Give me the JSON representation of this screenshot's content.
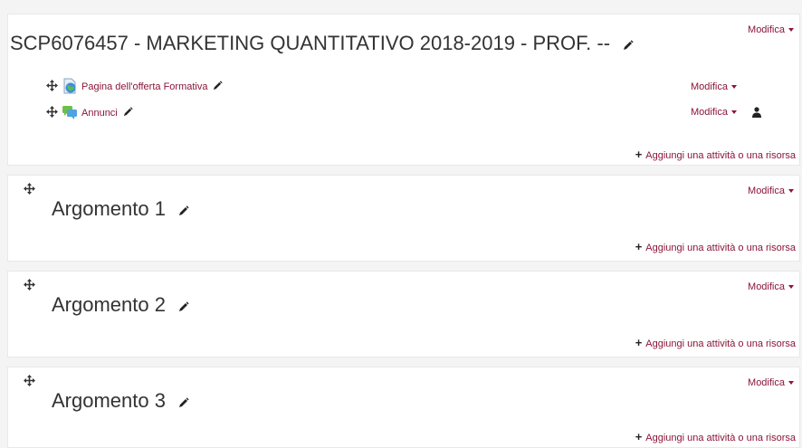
{
  "sections": [
    {
      "title": "SCP6076457 - MARKETING QUANTITATIVO 2018-2019 - PROF. --",
      "edit_label": "Modifica",
      "add_label": "Aggiungi una attività o una risorsa",
      "activities": [
        {
          "name": "Pagina dell'offerta Formativa",
          "icon": "page-globe-icon",
          "edit_label": "Modifica"
        },
        {
          "name": "Annunci",
          "icon": "forum-icon",
          "edit_label": "Modifica",
          "extra_icon": "user-icon"
        }
      ]
    },
    {
      "title": "Argomento 1",
      "edit_label": "Modifica",
      "add_label": "Aggiungi una attività o una risorsa"
    },
    {
      "title": "Argomento 2",
      "edit_label": "Modifica",
      "add_label": "Aggiungi una attività o una risorsa"
    },
    {
      "title": "Argomento 3",
      "edit_label": "Modifica",
      "add_label": "Aggiungi una attività o una risorsa"
    }
  ],
  "colors": {
    "link": "#8a1538",
    "text": "#333333",
    "background": "#f4f4f4"
  }
}
